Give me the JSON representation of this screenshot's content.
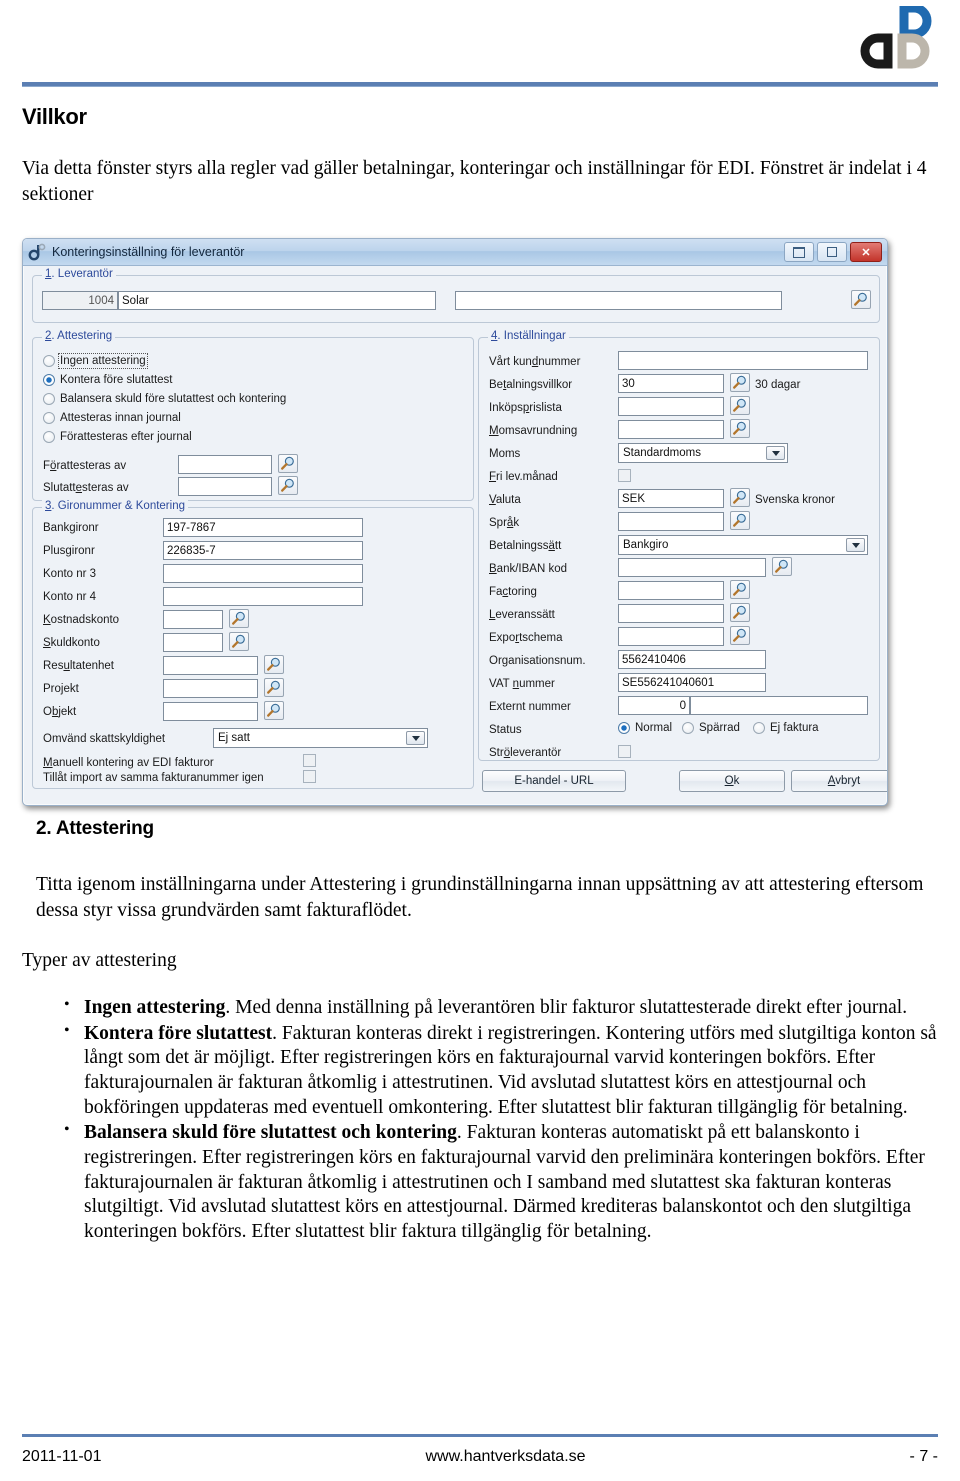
{
  "header": {
    "logo_alt": "ab-logo",
    "title": "Villkor",
    "intro": "Via detta fönster styrs alla regler vad gäller betalningar, konteringar och inställningar för EDI. Fönstret är indelat i 4 sektioner"
  },
  "dialog": {
    "title": "Konteringsinställning för leverantör",
    "window_buttons": {
      "minimize": "minimize",
      "maximize": "maximize",
      "close": "✕"
    },
    "section1": {
      "legend": "1. Leverantör",
      "legend_prefix": "1",
      "legend_rest": ". Leverantör",
      "supplier_no": "1004",
      "supplier_name": "Solar",
      "supplier_extra": "",
      "lookup_icon": "magnifier-icon"
    },
    "section2": {
      "legend_prefix": "2",
      "legend_rest": ". Attestering",
      "options": [
        {
          "label": "Ingen attestering",
          "selected": false,
          "focused": true
        },
        {
          "label": "Kontera före slutattest",
          "selected": true,
          "focused": false
        },
        {
          "label": "Balansera skuld före slutattest och kontering",
          "selected": false,
          "focused": false
        },
        {
          "label": "Attesteras innan journal",
          "selected": false,
          "focused": false
        },
        {
          "label": "Förattesteras efter journal",
          "selected": false,
          "focused": false
        }
      ],
      "fields": [
        {
          "label_a": "F",
          "label_u": "ö",
          "label_b": "rattesteras av",
          "value": ""
        },
        {
          "label_a": "Slutatt",
          "label_u": "e",
          "label_b": "steras av",
          "value": ""
        }
      ]
    },
    "section3": {
      "legend_prefix": "3",
      "legend_rest": ". Gironummer & Kontering",
      "rows": [
        {
          "label": "Bankgironr",
          "value": "197-7867",
          "wide": true,
          "mag": false
        },
        {
          "label": "Plusgironr",
          "value": "226835-7",
          "wide": true,
          "mag": false
        },
        {
          "label": "Konto nr 3",
          "value": "",
          "wide": true,
          "mag": false
        },
        {
          "label": "Konto nr 4",
          "value": "",
          "wide": true,
          "mag": false
        },
        {
          "label": "Kostnadskonto",
          "value": "",
          "wide": false,
          "mag": true
        },
        {
          "label": "Skuldkonto",
          "value": "",
          "wide": false,
          "mag": true
        },
        {
          "label": "Resultatenhet",
          "value": "",
          "wide": false,
          "mag": true
        },
        {
          "label": "Projekt",
          "value": "",
          "wide": false,
          "mag": true
        },
        {
          "label": "Objekt",
          "value": "",
          "wide": false,
          "mag": true
        }
      ],
      "reverse_tax_label": "Omvänd skattskyldighet",
      "reverse_tax_value": "Ej satt",
      "checkbox1_label": "Manuell kontering av EDI fakturor",
      "checkbox1_checked": false,
      "checkbox2_label": "Tillåt import av samma fakturanummer igen",
      "checkbox2_checked": false
    },
    "section4": {
      "legend_prefix": "4",
      "legend_rest": ". Inställningar",
      "rows": [
        {
          "label": "Vårt kundnummer",
          "value": "",
          "type": "wide-text",
          "mag": false,
          "hint": ""
        },
        {
          "label": "Betalningsvillkor",
          "value": "30",
          "type": "text",
          "mag": true,
          "hint": "30 dagar"
        },
        {
          "label": "Inköpsprislista",
          "value": "",
          "type": "text",
          "mag": true,
          "hint": ""
        },
        {
          "label": "Momsavrundning",
          "value": "",
          "type": "text",
          "mag": true,
          "hint": ""
        },
        {
          "label": "Moms",
          "value": "Standardmoms",
          "type": "combo-sm",
          "mag": false,
          "hint": ""
        },
        {
          "label": "Fri lev.månad",
          "value": "",
          "type": "checkbox",
          "mag": false,
          "hint": ""
        },
        {
          "label": "Valuta",
          "value": "SEK",
          "type": "text",
          "mag": true,
          "hint": "Svenska kronor"
        },
        {
          "label": "Språk",
          "value": "",
          "type": "text",
          "mag": true,
          "hint": ""
        },
        {
          "label": "Betalningssätt",
          "value": "Bankgiro",
          "type": "combo-lg",
          "mag": false,
          "hint": ""
        },
        {
          "label": "Bank/IBAN kod",
          "value": "",
          "type": "text-md",
          "mag": true,
          "hint": ""
        },
        {
          "label": "Factoring",
          "value": "",
          "type": "text",
          "mag": true,
          "hint": ""
        },
        {
          "label": "Leveranssätt",
          "value": "",
          "type": "text",
          "mag": true,
          "hint": ""
        },
        {
          "label": "Exportschema",
          "value": "",
          "type": "text",
          "mag": true,
          "hint": ""
        },
        {
          "label": "Organisationsnum.",
          "value": "5562410406",
          "type": "text-md",
          "mag": false,
          "hint": ""
        },
        {
          "label": "VAT nummer",
          "value": "SE556241040601",
          "type": "text-md",
          "mag": false,
          "hint": ""
        },
        {
          "label": "Externt nummer",
          "value": "0",
          "type": "num-pair",
          "mag": false,
          "hint": ""
        }
      ],
      "status_label": "Status",
      "status_options": [
        {
          "label": "Normal",
          "selected": true
        },
        {
          "label": "Spärrad",
          "selected": false
        },
        {
          "label": "Ej faktura",
          "selected": false
        }
      ],
      "stray_label": "Ströleverantör",
      "stray_checked": false
    },
    "buttons": {
      "ehandel": "E-handel - URL",
      "ok": "Ok",
      "cancel": "Avbryt"
    }
  },
  "body": {
    "section_heading": "2. Attestering",
    "paragraph1": "Titta igenom inställningarna under Attestering i grundinställningarna innan uppsättning av att attestering eftersom dessa styr vissa grundvärden samt fakturaflödet.",
    "paragraph2": "Typer av attestering",
    "bullets": [
      {
        "term": "Ingen attestering",
        "text": ". Med denna inställning på leverantören blir fakturor slutattesterade direkt efter journal."
      },
      {
        "term": "Kontera före slutattest",
        "text": ". Fakturan konteras direkt i registreringen. Kontering utförs med slutgiltiga konton så långt som det är möjligt. Efter registreringen körs en fakturajournal varvid konteringen bokförs. Efter fakturajournalen är fakturan åtkomlig i attestrutinen. Vid avslutad slutattest körs en attestjournal och bokföringen uppdateras med eventuell omkontering. Efter slutattest blir fakturan tillgänglig för betalning."
      },
      {
        "term": "Balansera skuld före slutattest och kontering",
        "text": ". Fakturan konteras automatiskt på ett balanskonto i registreringen. Efter registreringen körs en fakturajournal varvid den preliminära konteringen bokförs. Efter fakturajournalen är fakturan åtkomlig i attestrutinen och I samband med slutattest ska fakturan konteras slutgiltigt. Vid avslutad slutattest körs en attestjournal. Därmed krediteras balanskontot och den slutgiltiga konteringen bokförs. Efter slutattest blir faktura tillgänglig för betalning."
      }
    ]
  },
  "footer": {
    "date": "2011-11-01",
    "site": "www.hantverksdata.se",
    "page": "- 7 -"
  },
  "colors": {
    "rule": "#5b7fb3",
    "legend": "#2d4a9b",
    "logo_blue": "#1f6ab0",
    "logo_dark": "#1a1a1a",
    "logo_grey": "#bcb6ab",
    "titlebar": "#bdd4ec",
    "close_red": "#c3342b"
  }
}
